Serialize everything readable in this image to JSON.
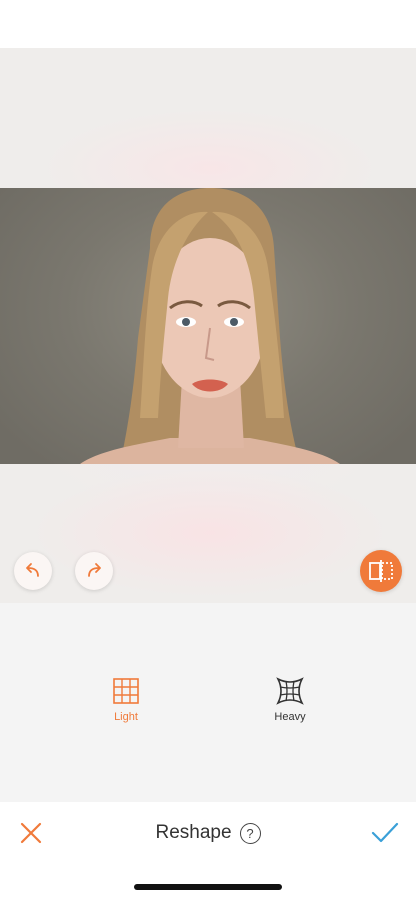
{
  "tools": {
    "light_label": "Light",
    "heavy_label": "Heavy"
  },
  "bottom_bar": {
    "title": "Reshape",
    "help_glyph": "?"
  },
  "icons": {
    "undo": "undo-icon",
    "redo": "redo-icon",
    "compare": "compare-icon",
    "light": "grid-light-icon",
    "heavy": "grid-heavy-icon",
    "cancel": "close-icon",
    "confirm": "check-icon",
    "help": "help-icon"
  },
  "colors": {
    "accent": "#f07a3a",
    "confirm": "#3aa0d8",
    "text": "#333333"
  }
}
